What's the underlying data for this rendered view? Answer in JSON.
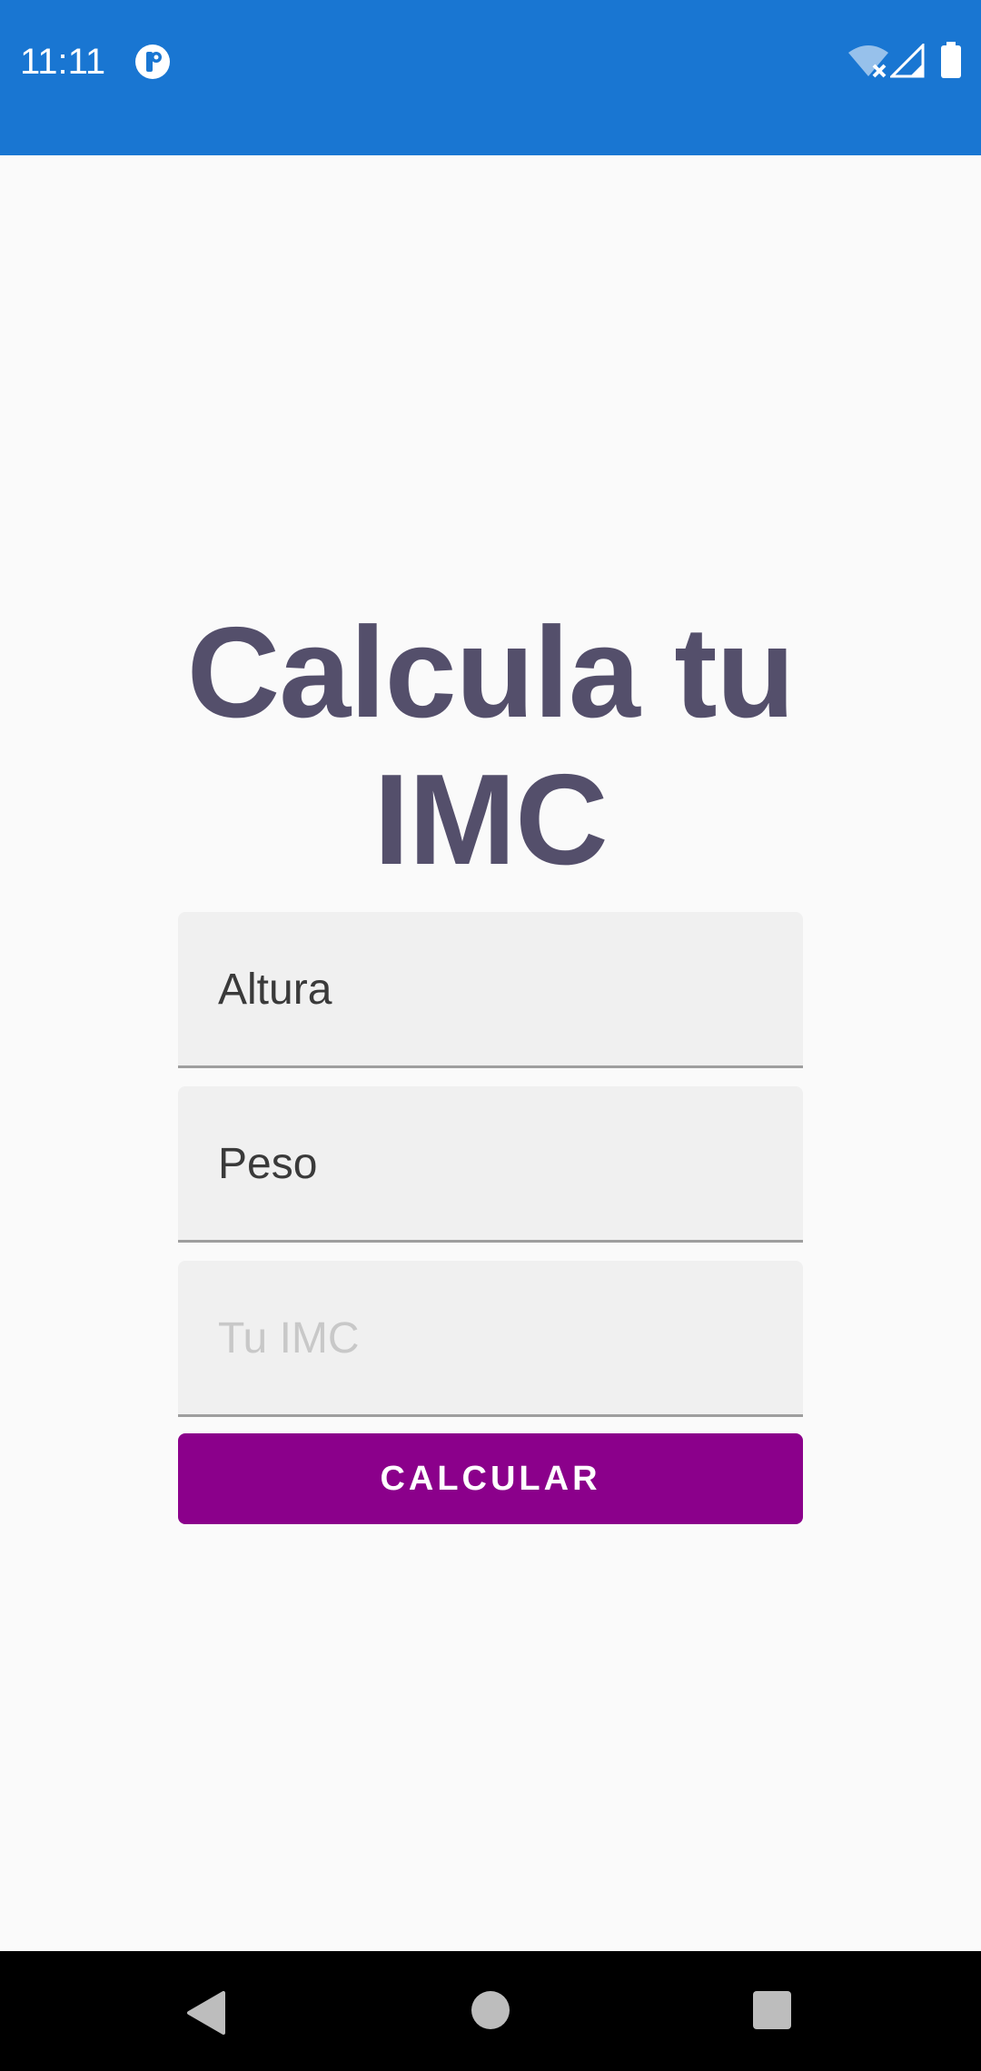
{
  "status_bar": {
    "time": "11:11",
    "background": "#1976D2",
    "icons": [
      "app-notification-icon",
      "wifi-off-icon",
      "cell-signal-icon",
      "battery-icon"
    ]
  },
  "title": {
    "line1": "Calcula tu",
    "line2": "IMC",
    "color": "#544F6B"
  },
  "form": {
    "altura_value": "Altura",
    "peso_value": "Peso",
    "imc_placeholder": "Tu IMC"
  },
  "button": {
    "label": "CALCULAR",
    "color": "#8B008B"
  },
  "nav_bar": {
    "icons": [
      "back-icon",
      "home-icon",
      "recents-icon"
    ]
  }
}
